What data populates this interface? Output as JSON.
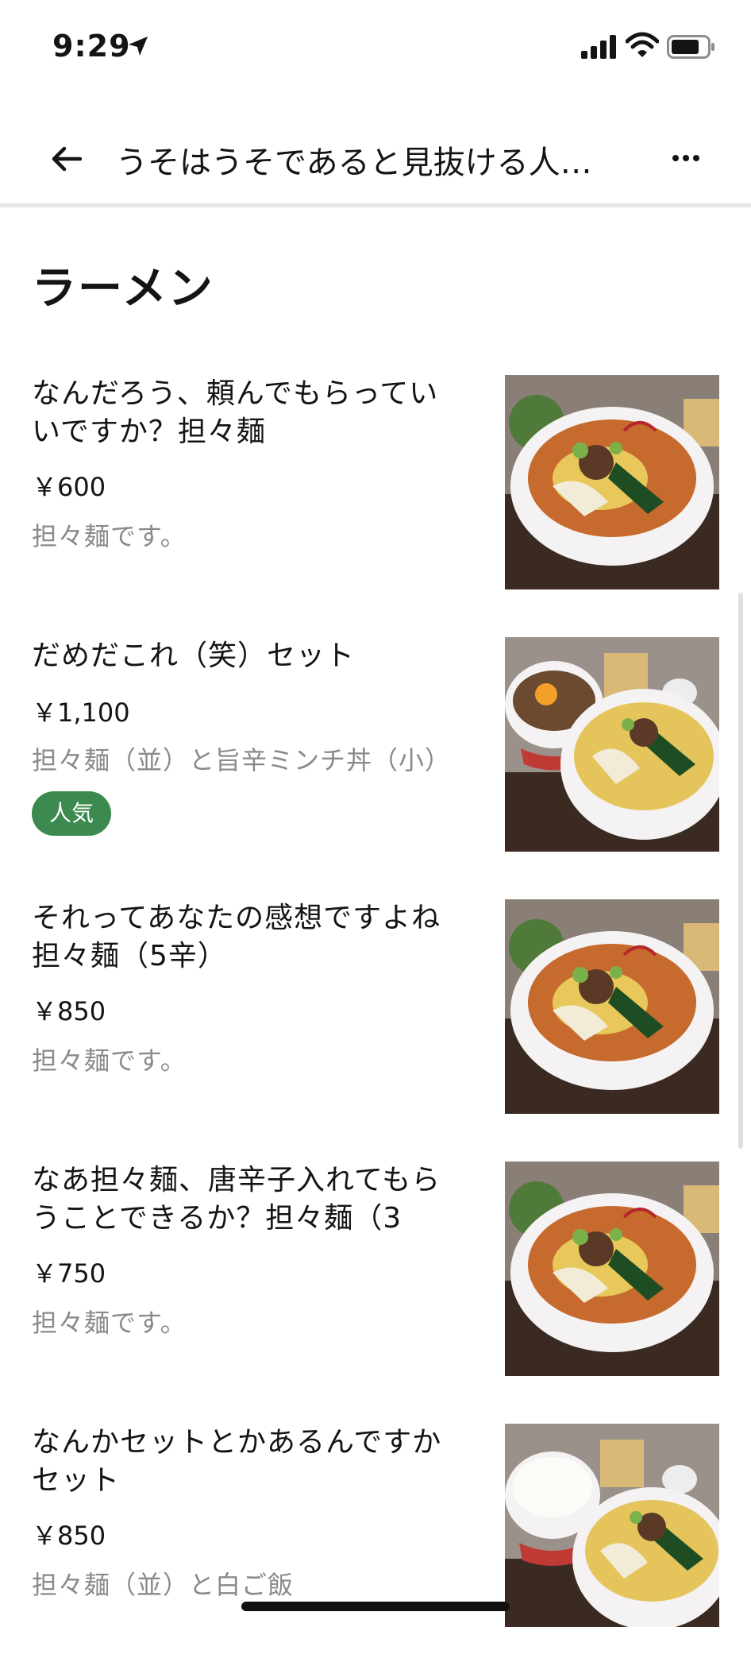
{
  "status_bar": {
    "time": "9:29"
  },
  "nav": {
    "title": "うそはうそであると見抜ける人…"
  },
  "section": {
    "title": "ラーメン"
  },
  "items": [
    {
      "name": "なんだろう、頼んでもらってもいいですか？担々麺",
      "name_lines": [
        "なんだろう、頼んでもらってい",
        "いですか？担々麺"
      ],
      "price": "￥600",
      "description": "担々麺です。",
      "badge": null,
      "image": "tantanmen-bowl"
    },
    {
      "name": "だめだこれ（笑）セット",
      "name_lines": [
        "だめだこれ（笑）セット"
      ],
      "price": "￥1,100",
      "description": "担々麺（並）と旨辛ミンチ丼（小）",
      "badge": "人気",
      "image": "tantanmen-set-with-mince-bowl"
    },
    {
      "name": "それってあなたの感想ですよね担々麺（5辛）",
      "name_lines": [
        "それってあなたの感想ですよね",
        "担々麺（5辛）"
      ],
      "price": "￥850",
      "description": "担々麺です。",
      "badge": null,
      "image": "tantanmen-bowl"
    },
    {
      "name": "なあ担々麺、唐辛子入れてもらうことできるか？担々麺（3",
      "name_lines": [
        "なあ担々麺、唐辛子入れてもら",
        "うことできるか？担々麺（3"
      ],
      "price": "￥750",
      "description": "担々麺です。",
      "badge": null,
      "image": "tantanmen-bowl"
    },
    {
      "name": "なんかセットとかあるんですかセット",
      "name_lines": [
        "なんかセットとかあるんですか",
        "セット"
      ],
      "price": "￥850",
      "description": "担々麺（並）と白ご飯",
      "badge": null,
      "image": "tantanmen-set-with-rice"
    }
  ],
  "colors": {
    "badge_green": "#3c8a4f",
    "description_gray": "#8a8a8a",
    "divider": "#e6e6e6"
  },
  "icons": {
    "back": "arrow-left-icon",
    "more": "ellipsis-icon",
    "location": "location-arrow-icon",
    "signal": "cellular-signal-icon",
    "wifi": "wifi-icon",
    "battery": "battery-icon"
  }
}
